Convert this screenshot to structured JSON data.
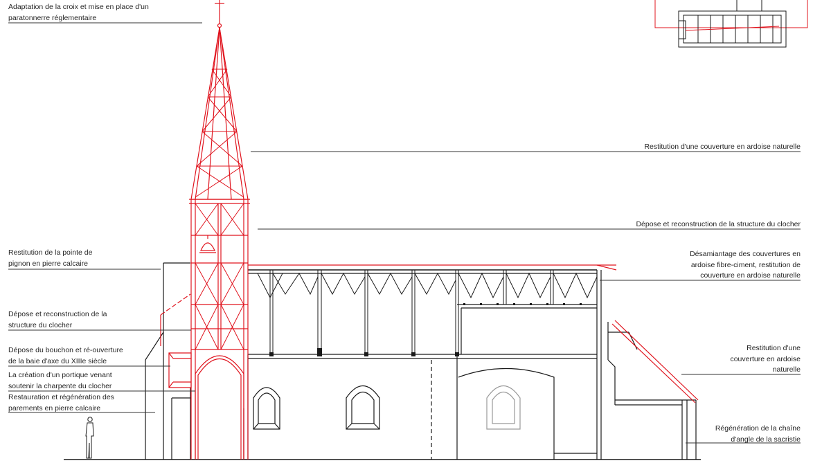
{
  "annotations_left": [
    {
      "id": "croix",
      "lines": [
        "Adaptation de la croix et mise en place d'un",
        "paratonnerre réglementaire"
      ]
    },
    {
      "id": "pignon",
      "lines": [
        "Restitution de la pointe de",
        "pignon en pierre calcaire"
      ]
    },
    {
      "id": "structure",
      "lines": [
        "Dépose et reconstruction de la",
        "structure du clocher"
      ]
    },
    {
      "id": "baie",
      "lines": [
        "Dépose du bouchon et ré-ouverture",
        "de la baie d'axe du XIIIe siècle"
      ]
    },
    {
      "id": "portique",
      "lines": [
        "La création d'un portique venant",
        "soutenir la charpente du clocher"
      ]
    },
    {
      "id": "parements",
      "lines": [
        "Restauration et régénération des",
        "parements en pierre calcaire"
      ]
    }
  ],
  "annotations_right": [
    {
      "id": "couverture-ardoise",
      "lines": [
        "Restitution d'une couverture en ardoise naturelle"
      ]
    },
    {
      "id": "structure-clocher",
      "lines": [
        "Dépose et reconstruction de la structure du clocher"
      ]
    },
    {
      "id": "desamiantage",
      "lines": [
        "Désamiantage des couvertures en",
        "ardoise fibre-ciment, restitution de",
        "couverture en ardoise naturelle"
      ]
    },
    {
      "id": "couverture-sacristie",
      "lines": [
        "Restitution d'une",
        "couverture en ardoise",
        "naturelle"
      ]
    },
    {
      "id": "chaine-angle",
      "lines": [
        "Régénération de la chaîne",
        "d'angle de la sacristie"
      ]
    }
  ],
  "colors": {
    "intervention": "#e0141e",
    "existing": "#1a1a1a",
    "leader": "#333333"
  }
}
